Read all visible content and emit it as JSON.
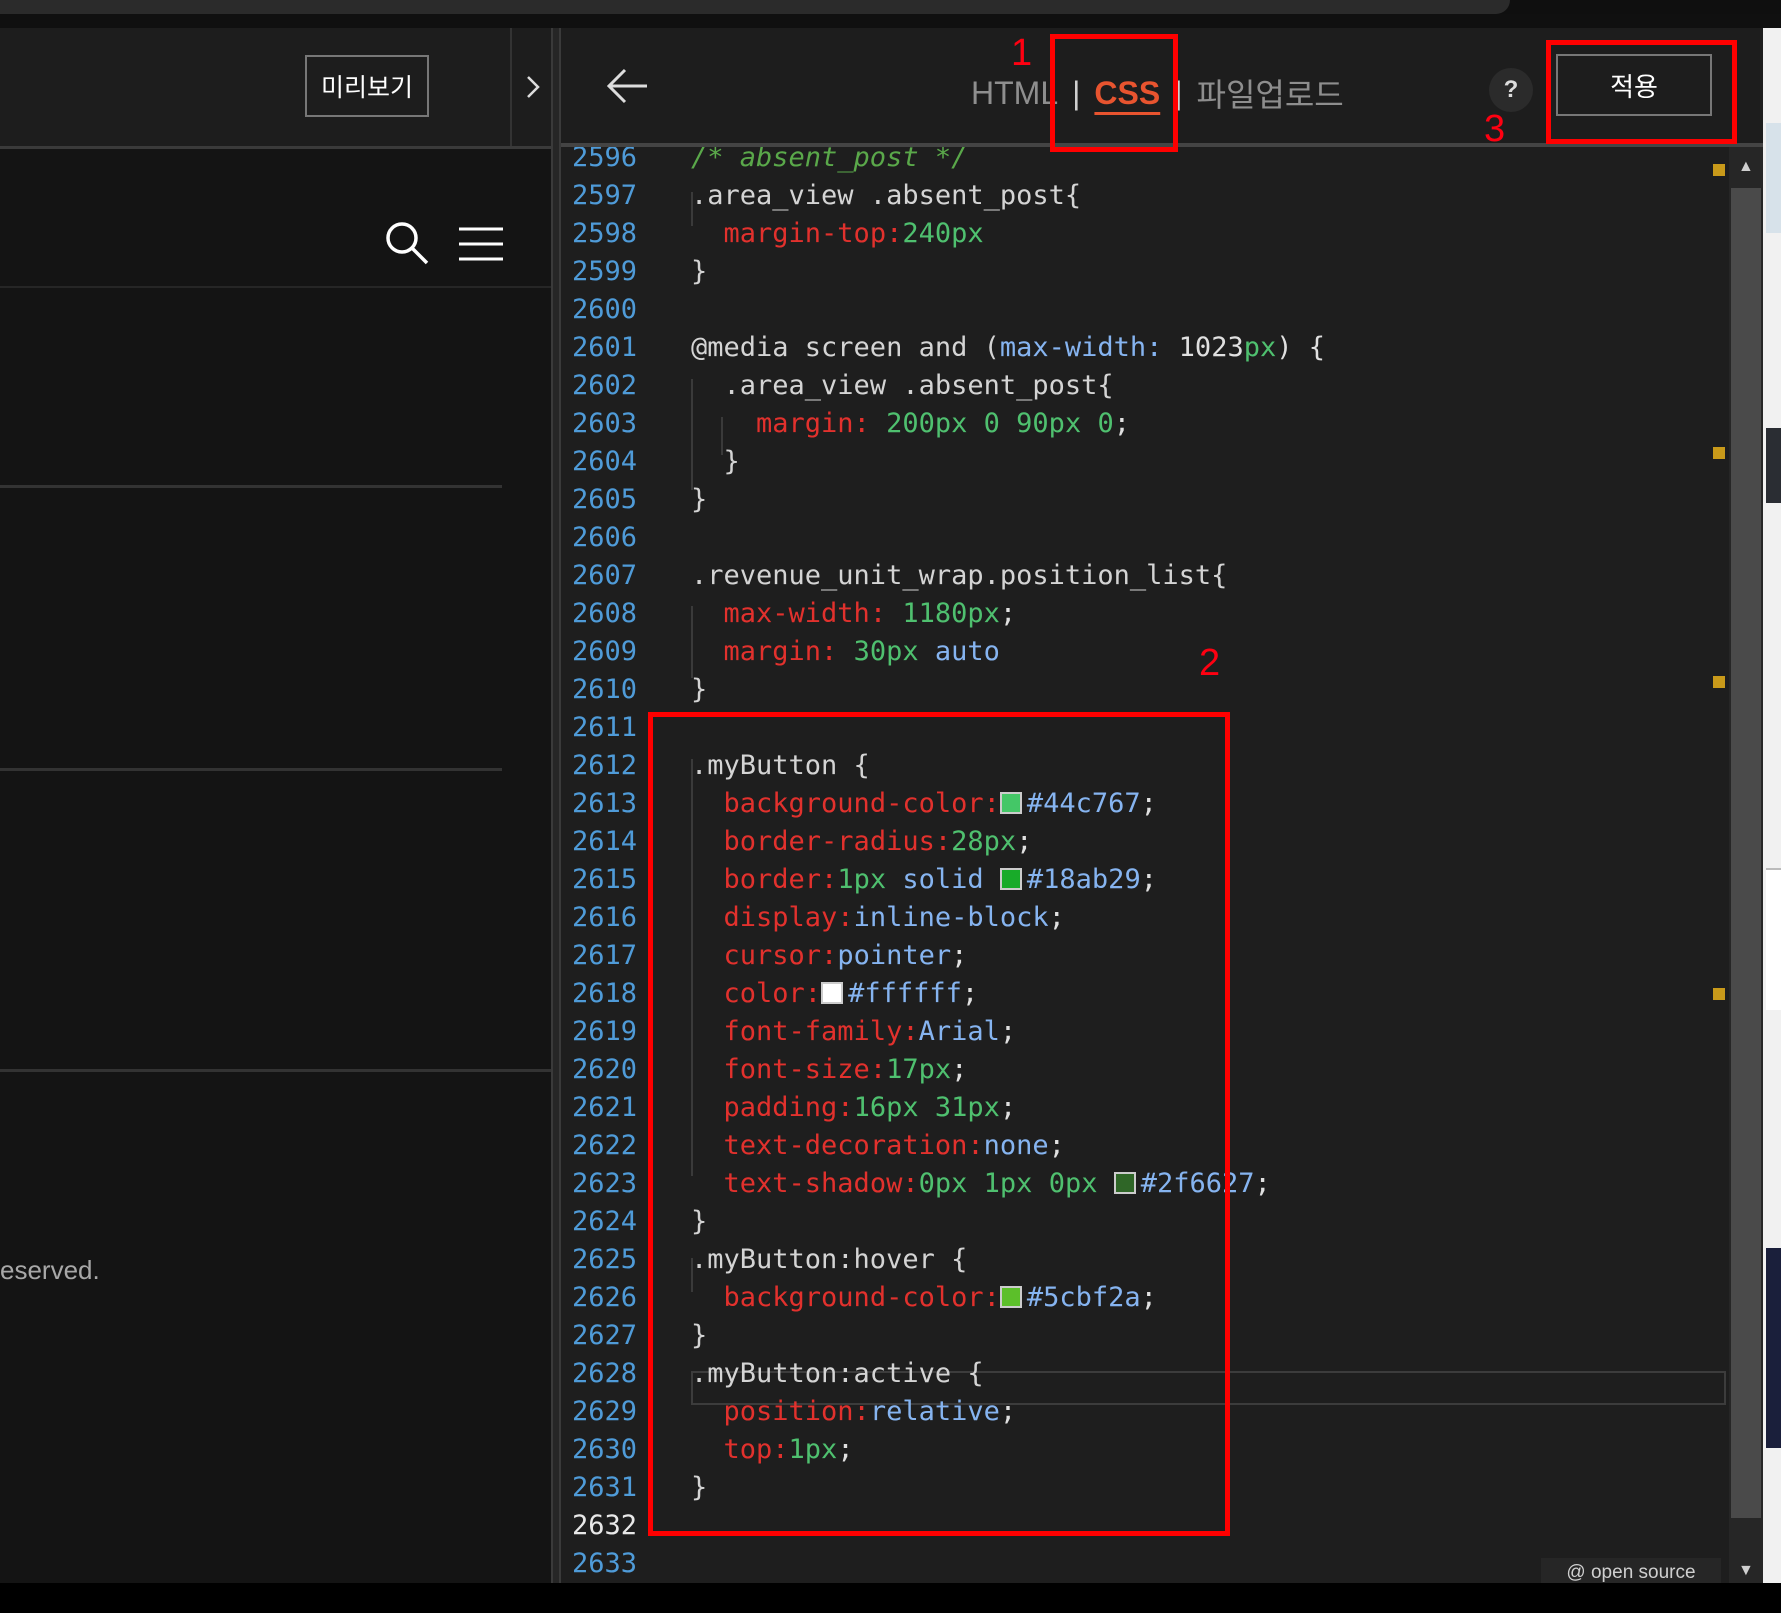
{
  "left_panel": {
    "preview_button": "미리보기",
    "footer_text": "eserved."
  },
  "toolbar": {
    "tab_html": "HTML",
    "tab_css": "CSS",
    "tab_upload": "파일업로드",
    "separator": "|",
    "help": "?",
    "apply_button": "적용"
  },
  "editor": {
    "lines": [
      {
        "n": "2596",
        "t": "/* absent_post */"
      },
      {
        "n": "2597",
        "t": ".area_view .absent_post{"
      },
      {
        "n": "2598",
        "t": "  margin-top:240px"
      },
      {
        "n": "2599",
        "t": "}"
      },
      {
        "n": "2600",
        "t": ""
      },
      {
        "n": "2601",
        "t": "@media screen and (max-width: 1023px) {"
      },
      {
        "n": "2602",
        "t": "  .area_view .absent_post{"
      },
      {
        "n": "2603",
        "t": "    margin: 200px 0 90px 0;"
      },
      {
        "n": "2604",
        "t": "  }"
      },
      {
        "n": "2605",
        "t": "}"
      },
      {
        "n": "2606",
        "t": ""
      },
      {
        "n": "2607",
        "t": ".revenue_unit_wrap.position_list{"
      },
      {
        "n": "2608",
        "t": "  max-width: 1180px;"
      },
      {
        "n": "2609",
        "t": "  margin: 30px auto"
      },
      {
        "n": "2610",
        "t": "}"
      },
      {
        "n": "2611",
        "t": ""
      },
      {
        "n": "2612",
        "t": ".myButton {"
      },
      {
        "n": "2613",
        "t": "  background-color:#44c767;"
      },
      {
        "n": "2614",
        "t": "  border-radius:28px;"
      },
      {
        "n": "2615",
        "t": "  border:1px solid #18ab29;"
      },
      {
        "n": "2616",
        "t": "  display:inline-block;"
      },
      {
        "n": "2617",
        "t": "  cursor:pointer;"
      },
      {
        "n": "2618",
        "t": "  color:#ffffff;"
      },
      {
        "n": "2619",
        "t": "  font-family:Arial;"
      },
      {
        "n": "2620",
        "t": "  font-size:17px;"
      },
      {
        "n": "2621",
        "t": "  padding:16px 31px;"
      },
      {
        "n": "2622",
        "t": "  text-decoration:none;"
      },
      {
        "n": "2623",
        "t": "  text-shadow:0px 1px 0px #2f6627;"
      },
      {
        "n": "2624",
        "t": "}"
      },
      {
        "n": "2625",
        "t": ".myButton:hover {"
      },
      {
        "n": "2626",
        "t": "  background-color:#5cbf2a;"
      },
      {
        "n": "2627",
        "t": "}"
      },
      {
        "n": "2628",
        "t": ".myButton:active {"
      },
      {
        "n": "2629",
        "t": "  position:relative;"
      },
      {
        "n": "2630",
        "t": "  top:1px;"
      },
      {
        "n": "2631",
        "t": "}"
      },
      {
        "n": "2632",
        "t": ""
      },
      {
        "n": "2633",
        "t": ""
      }
    ],
    "current_line": "2632",
    "footer_badge": "@ open source"
  },
  "annotations": [
    "1",
    "2",
    "3"
  ],
  "colors": {
    "accent_tab": "#e8542f",
    "annotation_red": "#ff0000",
    "swatch_44c767": "#44c767",
    "swatch_18ab29": "#18ab29",
    "swatch_ffffff": "#ffffff",
    "swatch_2f6627": "#2f6627",
    "swatch_5cbf2a": "#5cbf2a"
  }
}
